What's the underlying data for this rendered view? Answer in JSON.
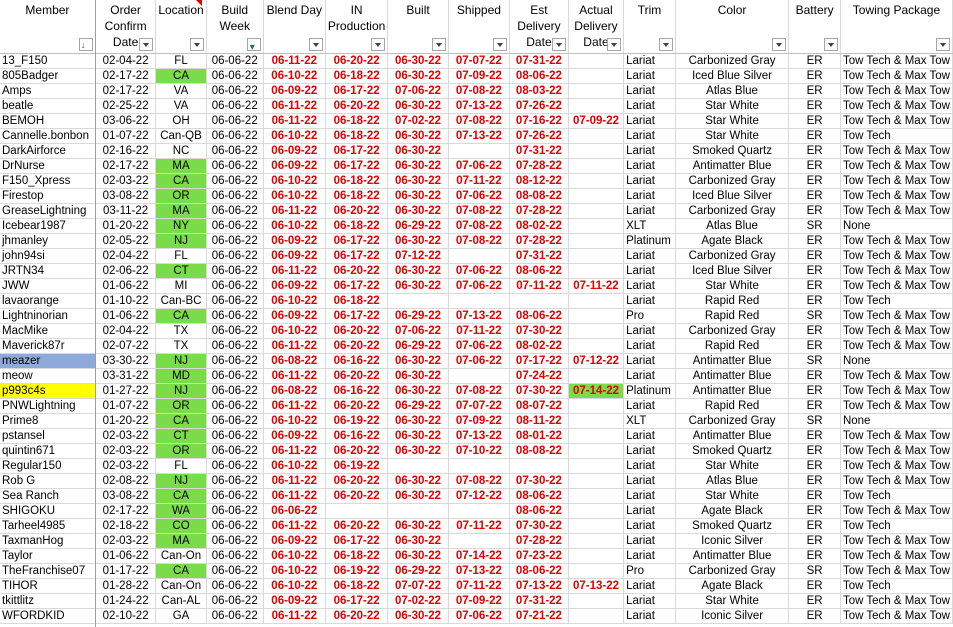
{
  "columns": [
    {
      "label": "Member",
      "filter": "sorted"
    },
    {
      "label": "Order Confirm Date",
      "filter": "normal"
    },
    {
      "label": "Location",
      "filter": "normal"
    },
    {
      "label": "Build Week",
      "filter": "filtered"
    },
    {
      "label": "Blend Day",
      "filter": "normal"
    },
    {
      "label": "IN Production",
      "filter": "normal"
    },
    {
      "label": "Built",
      "filter": "normal"
    },
    {
      "label": "Shipped",
      "filter": "normal"
    },
    {
      "label": "Est Delivery Date",
      "filter": "normal"
    },
    {
      "label": "Actual Delivery Date",
      "filter": "normal"
    },
    {
      "label": "Trim",
      "filter": "normal"
    },
    {
      "label": "Color",
      "filter": "normal"
    },
    {
      "label": "Battery",
      "filter": "normal"
    },
    {
      "label": "Towing Package",
      "filter": "normal"
    }
  ],
  "colors": {
    "green": "#7bdc4a",
    "yellow": "#ffff00",
    "blue": "#8ea9db",
    "red_text": "#e00000"
  },
  "rows": [
    [
      "13_F150",
      "02-04-22",
      "FL",
      "06-06-22",
      "06-11-22",
      "06-20-22",
      "06-30-22",
      "07-07-22",
      "07-31-22",
      "",
      "Lariat",
      "Carbonized Gray",
      "ER",
      "Tow Tech & Max Tow"
    ],
    [
      "805Badger",
      "02-17-22",
      "CA",
      "06-06-22",
      "06-10-22",
      "06-18-22",
      "06-30-22",
      "07-09-22",
      "08-06-22",
      "",
      "Lariat",
      "Iced Blue Silver",
      "ER",
      "Tow Tech & Max Tow"
    ],
    [
      "Amps",
      "02-17-22",
      "VA",
      "06-06-22",
      "06-09-22",
      "06-17-22",
      "07-06-22",
      "07-08-22",
      "08-03-22",
      "",
      "Lariat",
      "Atlas Blue",
      "ER",
      "Tow Tech & Max Tow"
    ],
    [
      "beatle",
      "02-25-22",
      "VA",
      "06-06-22",
      "06-11-22",
      "06-20-22",
      "06-30-22",
      "07-13-22",
      "07-26-22",
      "",
      "Lariat",
      "Star White",
      "ER",
      "Tow Tech & Max Tow"
    ],
    [
      "BEMOH",
      "03-06-22",
      "OH",
      "06-06-22",
      "06-11-22",
      "06-18-22",
      "07-02-22",
      "07-08-22",
      "07-16-22",
      "07-09-22",
      "Lariat",
      "Star White",
      "ER",
      "Tow Tech & Max Tow"
    ],
    [
      "Cannelle.bonbon",
      "01-07-22",
      "Can-QB",
      "06-06-22",
      "06-10-22",
      "06-18-22",
      "06-30-22",
      "07-13-22",
      "07-26-22",
      "",
      "Lariat",
      "Star White",
      "ER",
      "Tow Tech"
    ],
    [
      "DarkAirforce",
      "02-16-22",
      "NC",
      "06-06-22",
      "06-09-22",
      "06-17-22",
      "06-30-22",
      "",
      "07-31-22",
      "",
      "Lariat",
      "Smoked Quartz",
      "ER",
      "Tow Tech & Max Tow"
    ],
    [
      "DrNurse",
      "02-17-22",
      "MA",
      "06-06-22",
      "06-09-22",
      "06-17-22",
      "06-30-22",
      "07-06-22",
      "07-28-22",
      "",
      "Lariat",
      "Antimatter Blue",
      "ER",
      "Tow Tech & Max Tow"
    ],
    [
      "F150_Xpress",
      "02-03-22",
      "CA",
      "06-06-22",
      "06-10-22",
      "06-18-22",
      "06-30-22",
      "07-11-22",
      "08-12-22",
      "",
      "Lariat",
      "Carbonized Gray",
      "ER",
      "Tow Tech & Max Tow"
    ],
    [
      "Firestop",
      "03-08-22",
      "OR",
      "06-06-22",
      "06-10-22",
      "06-18-22",
      "06-30-22",
      "07-06-22",
      "08-08-22",
      "",
      "Lariat",
      "Iced Blue Silver",
      "ER",
      "Tow Tech & Max Tow"
    ],
    [
      "GreaseLightning",
      "03-11-22",
      "MA",
      "06-06-22",
      "06-11-22",
      "06-20-22",
      "06-30-22",
      "07-08-22",
      "07-28-22",
      "",
      "Lariat",
      "Carbonized Gray",
      "ER",
      "Tow Tech & Max Tow"
    ],
    [
      "Icebear1987",
      "01-20-22",
      "NY",
      "06-06-22",
      "06-10-22",
      "06-18-22",
      "06-29-22",
      "07-08-22",
      "08-02-22",
      "",
      "XLT",
      "Atlas Blue",
      "SR",
      "None"
    ],
    [
      "jhmanley",
      "02-05-22",
      "NJ",
      "06-06-22",
      "06-09-22",
      "06-17-22",
      "06-30-22",
      "07-08-22",
      "07-28-22",
      "",
      "Platinum",
      "Agate Black",
      "ER",
      "Tow Tech & Max Tow"
    ],
    [
      "john94si",
      "02-04-22",
      "FL",
      "06-06-22",
      "06-09-22",
      "06-17-22",
      "07-12-22",
      "",
      "07-31-22",
      "",
      "Lariat",
      "Carbonized Gray",
      "ER",
      "Tow Tech & Max Tow"
    ],
    [
      "JRTN34",
      "02-06-22",
      "CT",
      "06-06-22",
      "06-11-22",
      "06-20-22",
      "06-30-22",
      "07-06-22",
      "08-06-22",
      "",
      "Lariat",
      "Iced Blue Silver",
      "ER",
      "Tow Tech & Max Tow"
    ],
    [
      "JWW",
      "01-06-22",
      "MI",
      "06-06-22",
      "06-09-22",
      "06-17-22",
      "06-30-22",
      "07-06-22",
      "07-11-22",
      "07-11-22",
      "Lariat",
      "Star White",
      "ER",
      "Tow Tech & Max Tow"
    ],
    [
      "lavaorange",
      "01-10-22",
      "Can-BC",
      "06-06-22",
      "06-10-22",
      "06-18-22",
      "",
      "",
      "",
      "",
      "Lariat",
      "Rapid Red",
      "ER",
      "Tow Tech"
    ],
    [
      "Lightninorian",
      "01-06-22",
      "CA",
      "06-06-22",
      "06-09-22",
      "06-17-22",
      "06-29-22",
      "07-13-22",
      "08-06-22",
      "",
      "Pro",
      "Rapid Red",
      "SR",
      "Tow Tech & Max Tow"
    ],
    [
      "MacMike",
      "02-04-22",
      "TX",
      "06-06-22",
      "06-10-22",
      "06-20-22",
      "07-06-22",
      "07-11-22",
      "07-30-22",
      "",
      "Lariat",
      "Carbonized Gray",
      "ER",
      "Tow Tech & Max Tow"
    ],
    [
      "Maverick87r",
      "02-07-22",
      "TX",
      "06-06-22",
      "06-11-22",
      "06-20-22",
      "06-29-22",
      "07-06-22",
      "08-02-22",
      "",
      "Lariat",
      "Rapid Red",
      "ER",
      "Tow Tech & Max Tow"
    ],
    [
      "meazer",
      "03-30-22",
      "NJ",
      "06-06-22",
      "06-08-22",
      "06-16-22",
      "06-30-22",
      "07-06-22",
      "07-17-22",
      "07-12-22",
      "Lariat",
      "Antimatter Blue",
      "SR",
      "None"
    ],
    [
      "meow",
      "03-31-22",
      "MD",
      "06-06-22",
      "06-11-22",
      "06-20-22",
      "06-30-22",
      "",
      "07-24-22",
      "",
      "Lariat",
      "Antimatter Blue",
      "ER",
      "Tow Tech & Max Tow"
    ],
    [
      "p993c4s",
      "01-27-22",
      "NJ",
      "06-06-22",
      "06-08-22",
      "06-16-22",
      "06-30-22",
      "07-08-22",
      "07-30-22",
      "07-14-22",
      "Platinum",
      "Antimatter Blue",
      "ER",
      "Tow Tech & Max Tow"
    ],
    [
      "PNWLightning",
      "01-07-22",
      "OR",
      "06-06-22",
      "06-11-22",
      "06-20-22",
      "06-29-22",
      "07-07-22",
      "08-07-22",
      "",
      "Lariat",
      "Rapid Red",
      "ER",
      "Tow Tech & Max Tow"
    ],
    [
      "Prime8",
      "01-20-22",
      "CA",
      "06-06-22",
      "06-10-22",
      "06-19-22",
      "06-30-22",
      "07-09-22",
      "08-11-22",
      "",
      "XLT",
      "Carbonized Gray",
      "SR",
      "None"
    ],
    [
      "pstansel",
      "02-03-22",
      "CT",
      "06-06-22",
      "06-09-22",
      "06-16-22",
      "06-30-22",
      "07-13-22",
      "08-01-22",
      "",
      "Lariat",
      "Antimatter Blue",
      "ER",
      "Tow Tech & Max Tow"
    ],
    [
      "quintin671",
      "02-03-22",
      "OR",
      "06-06-22",
      "06-11-22",
      "06-20-22",
      "06-30-22",
      "07-10-22",
      "08-08-22",
      "",
      "Lariat",
      "Smoked Quartz",
      "ER",
      "Tow Tech & Max Tow"
    ],
    [
      "Regular150",
      "02-03-22",
      "FL",
      "06-06-22",
      "06-10-22",
      "06-19-22",
      "",
      "",
      "",
      "",
      "Lariat",
      "Star White",
      "ER",
      "Tow Tech & Max Tow"
    ],
    [
      "Rob G",
      "02-08-22",
      "NJ",
      "06-06-22",
      "06-11-22",
      "06-20-22",
      "06-30-22",
      "07-08-22",
      "07-30-22",
      "",
      "Lariat",
      "Atlas Blue",
      "ER",
      "Tow Tech & Max Tow"
    ],
    [
      "Sea Ranch",
      "03-08-22",
      "CA",
      "06-06-22",
      "06-11-22",
      "06-20-22",
      "06-30-22",
      "07-12-22",
      "08-06-22",
      "",
      "Lariat",
      "Star White",
      "ER",
      "Tow Tech"
    ],
    [
      "SHIGOKU",
      "02-17-22",
      "WA",
      "06-06-22",
      "06-06-22",
      "",
      "",
      "",
      "08-06-22",
      "",
      "Lariat",
      "Agate Black",
      "ER",
      "Tow Tech & Max Tow"
    ],
    [
      "Tarheel4985",
      "02-18-22",
      "CO",
      "06-06-22",
      "06-11-22",
      "06-20-22",
      "06-30-22",
      "07-11-22",
      "07-30-22",
      "",
      "Lariat",
      "Smoked Quartz",
      "ER",
      "Tow Tech"
    ],
    [
      "TaxmanHog",
      "02-03-22",
      "MA",
      "06-06-22",
      "06-09-22",
      "06-17-22",
      "06-30-22",
      "",
      "07-28-22",
      "",
      "Lariat",
      "Iconic Silver",
      "ER",
      "Tow Tech & Max Tow"
    ],
    [
      "Taylor",
      "01-06-22",
      "Can-On",
      "06-06-22",
      "06-10-22",
      "06-18-22",
      "06-30-22",
      "07-14-22",
      "07-23-22",
      "",
      "Lariat",
      "Antimatter Blue",
      "ER",
      "Tow Tech & Max Tow"
    ],
    [
      "TheFranchise07",
      "01-17-22",
      "CA",
      "06-06-22",
      "06-10-22",
      "06-19-22",
      "06-29-22",
      "07-13-22",
      "08-06-22",
      "",
      "Pro",
      "Carbonized Gray",
      "SR",
      "Tow Tech & Max Tow"
    ],
    [
      "TIHOR",
      "01-28-22",
      "Can-On",
      "06-06-22",
      "06-10-22",
      "06-18-22",
      "07-07-22",
      "07-11-22",
      "07-13-22",
      "07-13-22",
      "Lariat",
      "Agate Black",
      "ER",
      "Tow Tech"
    ],
    [
      "tkittlitz",
      "01-24-22",
      "Can-AL",
      "06-06-22",
      "06-09-22",
      "06-17-22",
      "07-02-22",
      "07-09-22",
      "07-31-22",
      "",
      "Lariat",
      "Star White",
      "ER",
      "Tow Tech & Max Tow"
    ],
    [
      "WFORDKID",
      "02-10-22",
      "GA",
      "06-06-22",
      "06-11-22",
      "06-20-22",
      "06-30-22",
      "07-06-22",
      "07-21-22",
      "",
      "Lariat",
      "Iconic Silver",
      "ER",
      "Tow Tech & Max Tow"
    ]
  ],
  "highlights": {
    "location_green": [
      1,
      7,
      8,
      9,
      10,
      11,
      12,
      14,
      17,
      20,
      21,
      22,
      23,
      24,
      25,
      26,
      28,
      29,
      30,
      31,
      32,
      34
    ],
    "member_yellow": [
      22
    ],
    "member_blue": [
      20
    ],
    "actual_green": [
      22
    ]
  }
}
